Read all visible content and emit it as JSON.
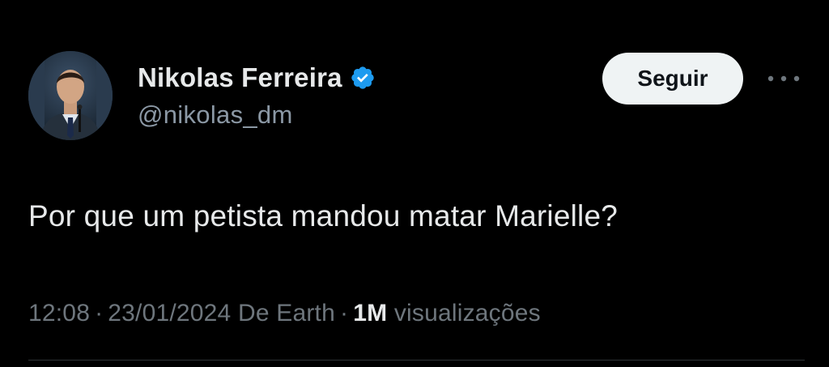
{
  "author": {
    "display_name": "Nikolas Ferreira",
    "handle": "@nikolas_dm",
    "verified_icon": "verified-badge-icon",
    "avatar_icon": "avatar"
  },
  "actions": {
    "follow_label": "Seguir",
    "more_icon": "more-options-icon"
  },
  "tweet": {
    "text": "Por que um petista mandou matar Marielle?"
  },
  "meta": {
    "time": "12:08",
    "separator": "·",
    "date": "23/01/2024",
    "source": "De Earth",
    "views_count": "1M",
    "views_label": "visualizações"
  },
  "colors": {
    "background": "#000000",
    "text_primary": "#e7e9ea",
    "text_secondary": "#6e767d",
    "verified": "#1d9bf0",
    "button_bg": "#eff3f4"
  }
}
